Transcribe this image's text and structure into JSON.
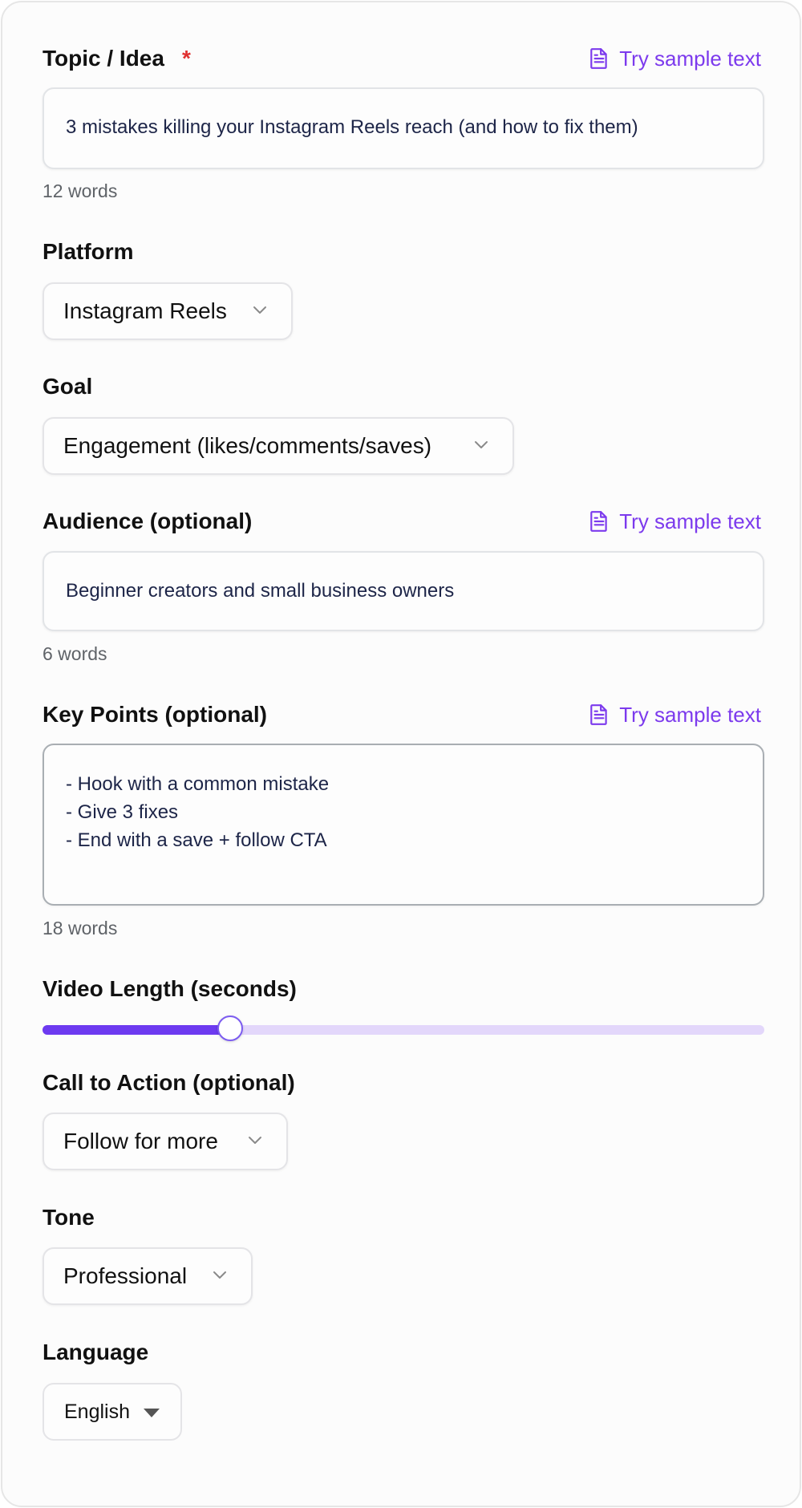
{
  "topic": {
    "label": "Topic / Idea",
    "required_mark": "*",
    "sample_link": "Try sample text",
    "value": "3 mistakes killing your Instagram Reels reach (and how to fix them)",
    "word_count": "12 words"
  },
  "platform": {
    "label": "Platform",
    "value": "Instagram Reels"
  },
  "goal": {
    "label": "Goal",
    "value": "Engagement (likes/comments/saves)"
  },
  "audience": {
    "label": "Audience (optional)",
    "sample_link": "Try sample text",
    "value": "Beginner creators and small business owners",
    "word_count": "6 words"
  },
  "key_points": {
    "label": "Key Points (optional)",
    "sample_link": "Try sample text",
    "lines": [
      "- Hook with a common mistake",
      "- Give 3 fixes",
      "- End with a save + follow CTA"
    ],
    "word_count": "18 words"
  },
  "video_length": {
    "label": "Video Length (seconds)",
    "fraction": 0.26
  },
  "cta": {
    "label": "Call to Action (optional)",
    "value": "Follow for more"
  },
  "tone": {
    "label": "Tone",
    "value": "Professional"
  },
  "language": {
    "label": "Language",
    "value": "English"
  },
  "colors": {
    "accent": "#7c3aed",
    "required": "#e03131",
    "slider_fill": "#6d3af0",
    "slider_track": "#e3d7fb"
  },
  "icons": {
    "sample_link": "document-icon",
    "select": "chevron-down-icon",
    "language_select": "caret-down-icon"
  }
}
